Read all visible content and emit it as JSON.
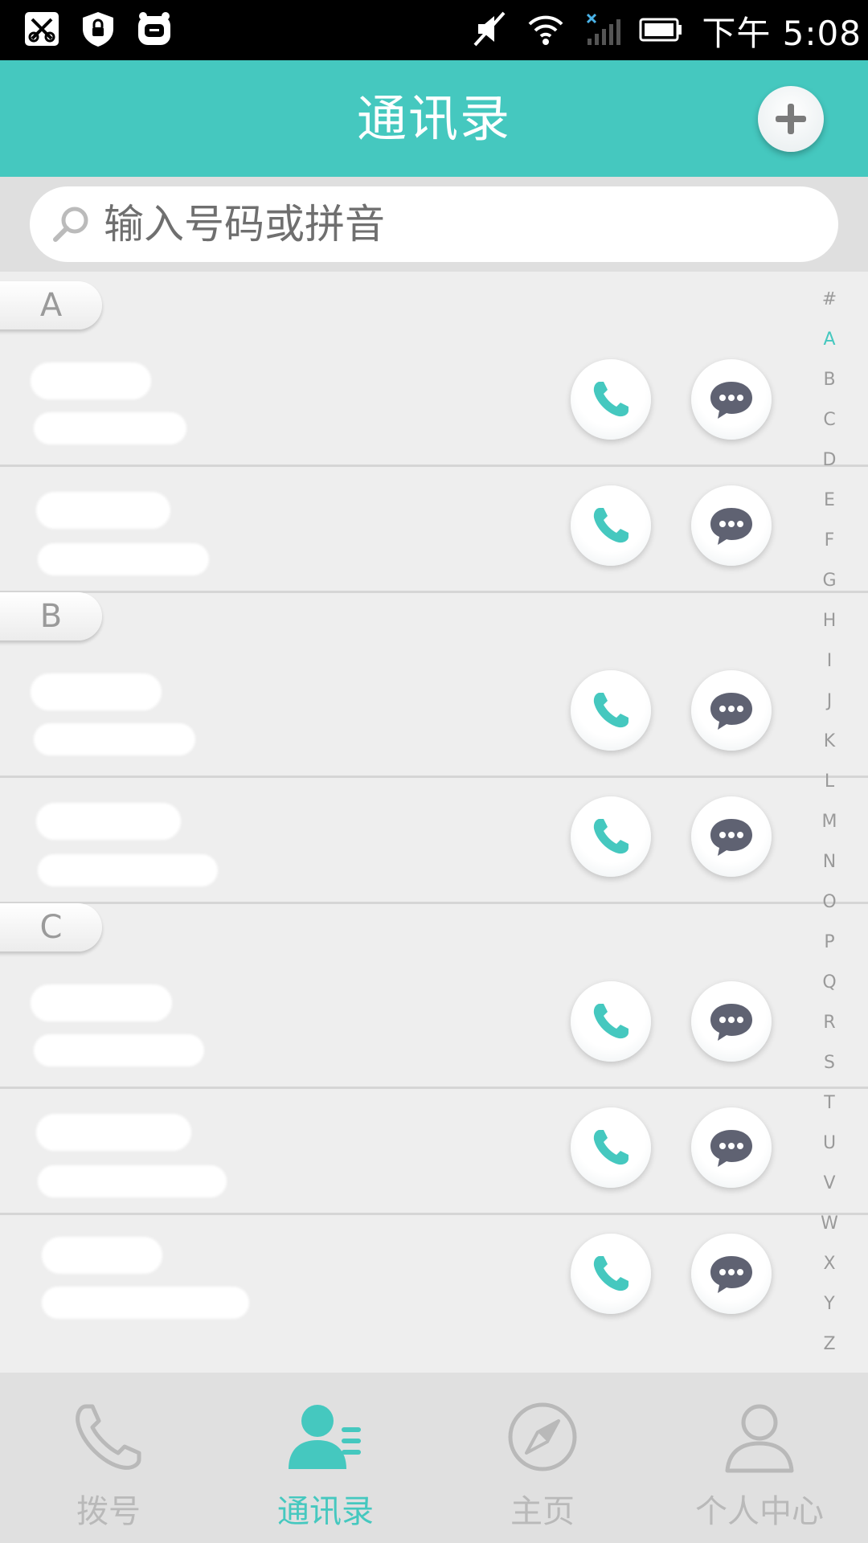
{
  "status_bar": {
    "time": "下午 5:08",
    "icons": [
      "scissors-notification-icon",
      "shield-notification-icon",
      "robot-notification-icon",
      "mute-icon",
      "wifi-icon",
      "no-signal-icon",
      "battery-icon"
    ]
  },
  "header": {
    "title": "通讯录",
    "add_button": "plus-icon"
  },
  "search": {
    "placeholder": "输入号码或拼音"
  },
  "sections": [
    {
      "letter": "A",
      "contacts": [
        {
          "name": "",
          "number": ""
        },
        {
          "name": "",
          "number": ""
        }
      ]
    },
    {
      "letter": "B",
      "contacts": [
        {
          "name": "",
          "number": ""
        },
        {
          "name": "",
          "number": ""
        }
      ]
    },
    {
      "letter": "C",
      "contacts": [
        {
          "name": "",
          "number": ""
        },
        {
          "name": "",
          "number": ""
        },
        {
          "name": "",
          "number": ""
        }
      ]
    }
  ],
  "index_bar": {
    "letters": [
      "#",
      "A",
      "B",
      "C",
      "D",
      "E",
      "F",
      "G",
      "H",
      "I",
      "J",
      "K",
      "L",
      "M",
      "N",
      "O",
      "P",
      "Q",
      "R",
      "S",
      "T",
      "U",
      "V",
      "W",
      "X",
      "Y",
      "Z"
    ],
    "active": "A"
  },
  "bottom_nav": {
    "items": [
      {
        "label": "拨号",
        "icon": "phone-icon"
      },
      {
        "label": "通讯录",
        "icon": "contacts-icon"
      },
      {
        "label": "主页",
        "icon": "compass-icon"
      },
      {
        "label": "个人中心",
        "icon": "person-icon"
      }
    ],
    "active_index": 1
  },
  "colors": {
    "accent": "#45c8bf",
    "message_icon": "#5f6272",
    "list_background": "#eeeeee"
  }
}
